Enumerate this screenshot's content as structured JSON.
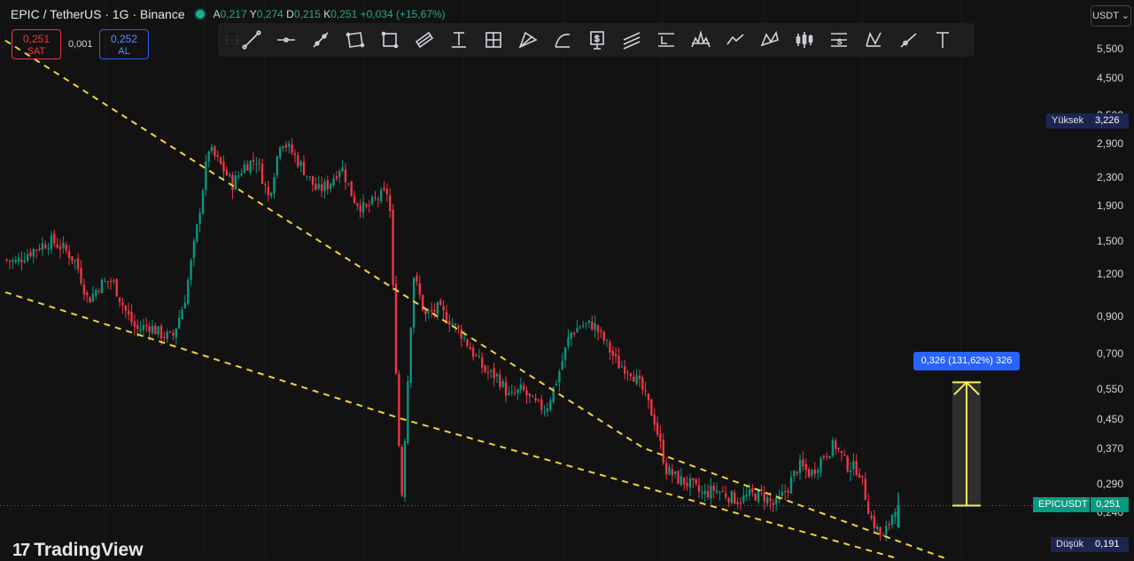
{
  "header": {
    "symbol_title": "EPIC / TetherUS · 1G · Binance",
    "ohlc": [
      {
        "label": "A",
        "value": "0,217"
      },
      {
        "label": "Y",
        "value": "0,274"
      },
      {
        "label": "D",
        "value": "0,215"
      },
      {
        "label": "K",
        "value": "0,251"
      }
    ],
    "change": "+0,034 (+15,67%)"
  },
  "trade_panel": {
    "sell_price": "0,251",
    "sell_label": "SAT",
    "spread": "0,001",
    "buy_price": "0,252",
    "buy_label": "AL"
  },
  "currency_selector": "USDT ⌄",
  "toolbar": {
    "tools": [
      "trend-line",
      "horizontal-ray",
      "info-line",
      "rectangle-box",
      "rectangle",
      "parallel-channel",
      "text-anchor",
      "crosshair",
      "pitchfork",
      "curve",
      "price-label",
      "multi-line",
      "long-position",
      "head-shoulders",
      "polyline",
      "xabcd-pattern",
      "bars-pattern",
      "fib-retracement",
      "abcd-pattern",
      "ray",
      "text"
    ]
  },
  "brand": "TradingView",
  "price_tags": {
    "high_label": "Yüksek",
    "high_value": "3,226",
    "last_label": "EPICUSDT",
    "last_value": "0,251",
    "low_label": "Düşük",
    "low_value": "0,191"
  },
  "measure_label": "0,326 (131,62%) 326",
  "colors": {
    "up": "#089981",
    "down": "#f23645",
    "trendline": "#f5d33a",
    "measure": "#ffee58",
    "measure_label": "#2962ff"
  },
  "chart_data": {
    "type": "candlestick",
    "y_scale": "log",
    "y_ticks": [
      "5,500",
      "4,500",
      "3,500",
      "2,900",
      "2,300",
      "1,900",
      "1,500",
      "1,200",
      "0,900",
      "0,700",
      "0,550",
      "0,450",
      "0,370",
      "0,290",
      "0,240",
      "0,190"
    ],
    "high": 3.226,
    "low": 0.191,
    "last": 0.251,
    "close_path": [
      1.32,
      1.3,
      1.38,
      1.45,
      1.5,
      1.42,
      1.3,
      1.0,
      1.12,
      1.15,
      0.95,
      0.82,
      0.85,
      0.8,
      0.78,
      1.0,
      1.6,
      2.8,
      2.5,
      2.2,
      2.5,
      2.6,
      2.0,
      3.0,
      2.7,
      2.4,
      2.1,
      2.2,
      2.5,
      2.0,
      1.85,
      2.0,
      2.1,
      0.25,
      1.2,
      0.9,
      0.95,
      0.88,
      0.8,
      0.7,
      0.62,
      0.6,
      0.52,
      0.55,
      0.5,
      0.48,
      0.6,
      0.8,
      0.85,
      0.85,
      0.75,
      0.65,
      0.63,
      0.55,
      0.45,
      0.32,
      0.3,
      0.29,
      0.27,
      0.28,
      0.27,
      0.26,
      0.27,
      0.27,
      0.25,
      0.28,
      0.33,
      0.31,
      0.35,
      0.38,
      0.33,
      0.32,
      0.23,
      0.2,
      0.251
    ],
    "trendlines": [
      {
        "points": [
          [
            0.0,
            5.8
          ],
          [
            53.0,
            0.37
          ],
          [
            78.0,
            0.176
          ]
        ]
      },
      {
        "points": [
          [
            0.0,
            1.06
          ],
          [
            33.0,
            0.45
          ],
          [
            74.0,
            0.176
          ]
        ]
      }
    ],
    "measure": {
      "from": 0.251,
      "to": 0.577,
      "delta": "0,326",
      "percent": "131,62%",
      "bars": "326"
    }
  }
}
